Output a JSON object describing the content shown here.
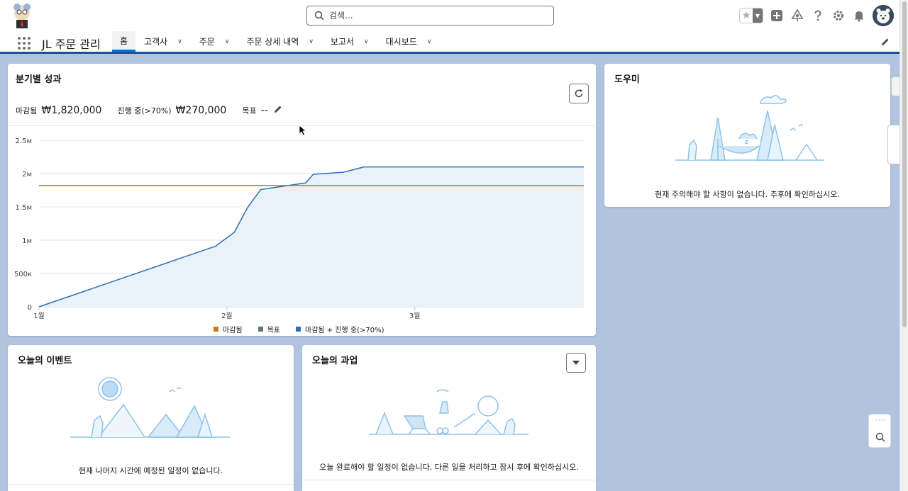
{
  "header": {
    "search_placeholder": "검색..."
  },
  "nav": {
    "app_name": "JL 주문 관리",
    "tabs": [
      {
        "label": "홈",
        "dropdown": false,
        "active": true
      },
      {
        "label": "고객사",
        "dropdown": true
      },
      {
        "label": "주문",
        "dropdown": true
      },
      {
        "label": "주문 상세 내역",
        "dropdown": true
      },
      {
        "label": "보고서",
        "dropdown": true
      },
      {
        "label": "대시보드",
        "dropdown": true
      }
    ]
  },
  "performance": {
    "title": "분기별 성과",
    "closed_label": "마감됨",
    "closed_value": "₩1,820,000",
    "open_label": "진행 중(>70%)",
    "open_value": "₩270,000",
    "goal_label": "목표",
    "goal_value": "--"
  },
  "chart_data": {
    "type": "line",
    "x_ticks": [
      "1월",
      "2월",
      "3월"
    ],
    "y_ticks": [
      "0",
      "500к",
      "1м",
      "1.5м",
      "2м",
      "2.5м"
    ],
    "ylim": [
      0,
      2500000
    ],
    "series": [
      {
        "name": "마감됨",
        "color": "#c77d12",
        "x": [
          0,
          2.9
        ],
        "y": [
          1820000,
          1820000
        ]
      },
      {
        "name": "목표",
        "color": "#5f7b73",
        "x": [],
        "y": []
      },
      {
        "name": "마감됨 + 진행 중(>70%)",
        "color": "#2d6fb3",
        "x": [
          0,
          0.94,
          1.04,
          1.11,
          1.18,
          1.42,
          1.46,
          1.62,
          1.73,
          2.9
        ],
        "y": [
          0,
          910000,
          1120000,
          1490000,
          1760000,
          1860000,
          1990000,
          2020000,
          2100000,
          2100000
        ]
      }
    ]
  },
  "helper": {
    "title": "도우미",
    "empty": "현재 주의해야 할 사항이 없습니다. 추후에 확인하십시오."
  },
  "events": {
    "title": "오늘의 이벤트",
    "empty": "현재 나머지 시간에 예정된 일정이 없습니다."
  },
  "tasks": {
    "title": "오늘의 과업",
    "empty": "오늘 완료해야 할 일정이 없습니다. 다른 일을 처리하고 잠시 후에 확인하십시오."
  },
  "colors": {
    "brand_blue": "#1b5297",
    "active_tab": "#0176d3",
    "background": "#b0c4df"
  }
}
